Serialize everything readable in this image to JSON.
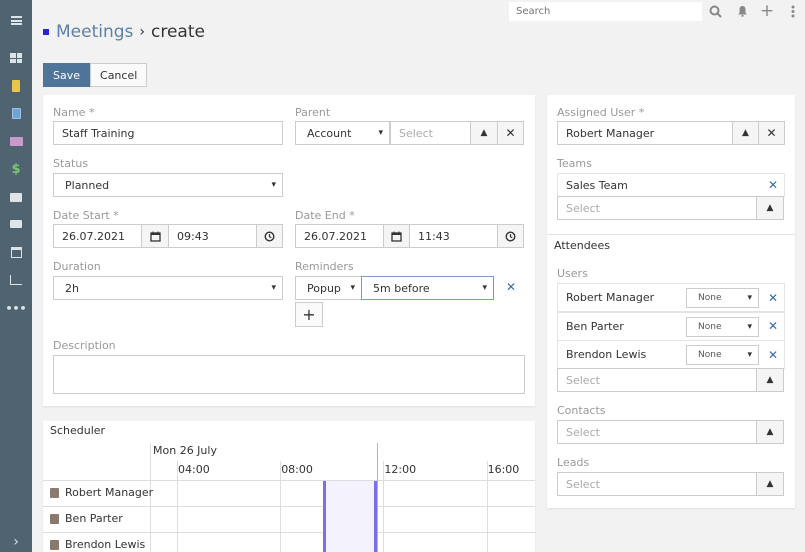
{
  "sidebar": {
    "items": [
      {
        "icon": "menu-icon"
      },
      {
        "icon": "dashboard-icon"
      },
      {
        "icon": "accounts-icon"
      },
      {
        "icon": "contacts-icon"
      },
      {
        "icon": "leads-icon"
      },
      {
        "icon": "opportunities-icon"
      },
      {
        "icon": "cases-icon"
      },
      {
        "icon": "emails-icon"
      },
      {
        "icon": "calendar-icon"
      },
      {
        "icon": "reports-icon"
      },
      {
        "icon": "more-icon"
      },
      {
        "icon": "expand-icon"
      }
    ],
    "dollar_glyph": "$",
    "more_glyph": "•••",
    "expand_glyph": "›"
  },
  "topbar": {
    "search_placeholder": "Search",
    "search_glyph": "⌕",
    "bell_glyph": "🔔",
    "plus_glyph": "+",
    "menu_glyph": "⋮"
  },
  "header": {
    "breadcrumb_parent": "Meetings",
    "separator": "›",
    "current": "create"
  },
  "actions": {
    "save_label": "Save",
    "cancel_label": "Cancel"
  },
  "form": {
    "name_label": "Name *",
    "name_value": "Staff Training",
    "parent_label": "Parent",
    "parent_type": "Account",
    "parent_placeholder": "Select",
    "status_label": "Status",
    "status_value": "Planned",
    "date_start_label": "Date Start *",
    "date_start_date": "26.07.2021",
    "date_start_time": "09:43",
    "date_end_label": "Date End *",
    "date_end_date": "26.07.2021",
    "date_end_time": "11:43",
    "duration_label": "Duration",
    "duration_value": "2h",
    "reminders_label": "Reminders",
    "reminder_type": "Popup",
    "reminder_time": "5m before",
    "description_label": "Description",
    "description_value": ""
  },
  "side": {
    "assigned_user_label": "Assigned User *",
    "assigned_user_value": "Robert Manager",
    "teams_label": "Teams",
    "teams": [
      "Sales Team"
    ],
    "teams_placeholder": "Select",
    "attendees_heading": "Attendees",
    "users_label": "Users",
    "users": [
      {
        "name": "Robert Manager",
        "status": "None"
      },
      {
        "name": "Ben Parter",
        "status": "None"
      },
      {
        "name": "Brendon Lewis",
        "status": "None"
      }
    ],
    "users_placeholder": "Select",
    "contacts_label": "Contacts",
    "contacts_placeholder": "Select",
    "leads_label": "Leads",
    "leads_placeholder": "Select"
  },
  "scheduler": {
    "title": "Scheduler",
    "day_label": "Mon 26 July",
    "ticks": [
      "04:00",
      "08:00",
      "12:00",
      "16:00"
    ],
    "rows": [
      "Robert Manager",
      "Ben Parter",
      "Brendon Lewis"
    ],
    "event_start": "09:43",
    "event_end": "11:43"
  },
  "glyphs": {
    "caret_down": "⌄",
    "caret_up": "⌃",
    "times": "✕",
    "plus": "+",
    "calendar": "▭",
    "clock": "◷"
  }
}
